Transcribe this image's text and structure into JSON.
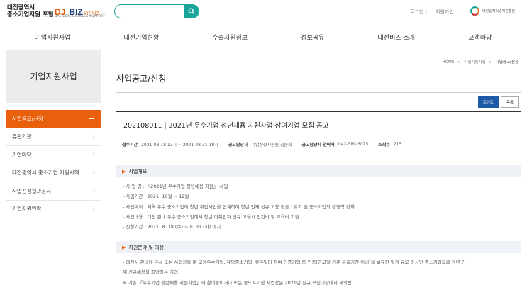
{
  "header": {
    "portal_line1": "대전광역시",
    "portal_line2": "중소기업지원 포털",
    "logo_dj": "DJ",
    "logo_biz": "BIZ",
    "logo_kor": "대전비즈",
    "logo_sub": "DAEJEON BUSINESS SUPPORT",
    "search_placeholder": "",
    "login": "로그인",
    "join": "회원가입",
    "agency": "대전일자리경제진흥원"
  },
  "gnb": [
    "기업지원사업",
    "대전기업현황",
    "수출지원정보",
    "정보공유",
    "대전비즈 소개",
    "고객마당"
  ],
  "lnb": {
    "title": "기업지원사업",
    "items": [
      "사업공고/신청",
      "유관기관",
      "기업마당",
      "대전광역시 중소기업 지원시책",
      "사업선정결과공지",
      "기업지원연락"
    ]
  },
  "content": {
    "breadcrumb": {
      "home": "HOME",
      "sep": ">",
      "parent": "기업지원사업",
      "current": "사업공고/신청"
    },
    "title": "사업공고/신청",
    "print": "프린트",
    "list": "목록",
    "notice_title": "202108011 | 2021년 우수기업 청년채용 지원사업 참여기업 모집 공고",
    "meta": {
      "period_label": "접수기간",
      "period_value": "2021-08-18 13시 ~ 2021-08-31 18시",
      "manager_label": "공고담당자",
      "manager_value": "기업성장지원팀 김은희",
      "contact_label": "공고담당자 연락처",
      "contact_value": "042-380-3075",
      "views_label": "조회수",
      "views_value": "215"
    },
    "section1": {
      "heading": "사업개요",
      "lines": [
        "- 사 업 명 : 『2021년 우수기업 청년채용 지원』 사업",
        "- 사업기간 : 2021. 10월 ~ 12월",
        "- 사업목적 : 지역 우수 중소기업에 청년 취업사업을 연계하여 청년 인재 신규 고용 창출 · 유지 및 중소기업의 경쟁력 강화",
        "- 사업내용 : 대전 관내 우수 중소기업에서 청년 미취업자 신규 고용시 인건비 및 교육비 지원",
        "- 신청기간 : 2021. 8. 18.(수) ~ 8. 31.(화) 까지"
      ]
    },
    "section2": {
      "heading": "지원분야 및 대상",
      "lines": [
        "- 대전시 관내에 본사 또는 사업장을 둔 고용우수기업, 유망중소기업, 좋은일터 참여·인증기업 등 인증(공고일 기준 유효기간 이내)을 보유한 일정 규모 이상인 중소기업으로 청년 인",
        "재 신규채용을 희망하는 기업",
        "※ 기존 「우수기업 청년채용 지원사업」에 참여중이거나 또는 중도포기한 사업장은 2021년 신규 모집대상에서 제외됨"
      ]
    }
  }
}
